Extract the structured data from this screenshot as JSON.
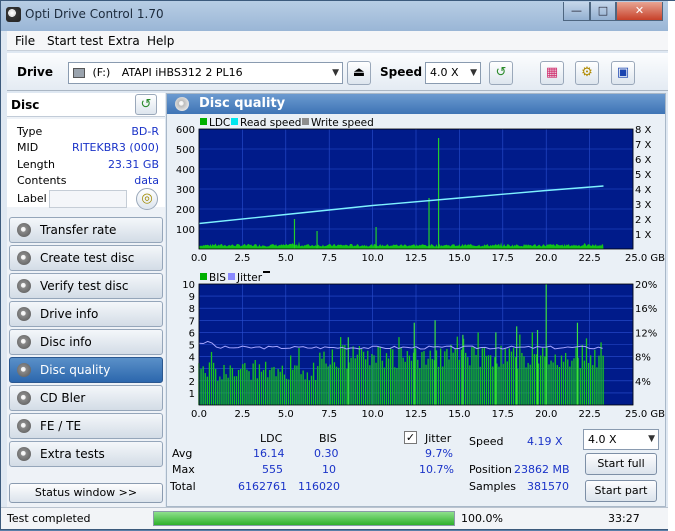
{
  "window": {
    "title": "Opti Drive Control 1.70"
  },
  "menu": {
    "file": "File",
    "start_test": "Start test",
    "extra": "Extra",
    "help": "Help"
  },
  "toolbar": {
    "drive_label": "Drive",
    "drive_letter": "(F:)",
    "drive_name": "ATAPI iHBS312  2 PL16",
    "speed_label": "Speed",
    "speed_value": "4.0 X"
  },
  "disc": {
    "heading": "Disc",
    "rows": [
      {
        "key": "Type",
        "value": "BD-R"
      },
      {
        "key": "MID",
        "value": "RITEKBR3 (000)"
      },
      {
        "key": "Length",
        "value": "23.31 GB"
      },
      {
        "key": "Contents",
        "value": "data"
      }
    ],
    "label_key": "Label",
    "label_value": ""
  },
  "nav": [
    {
      "label": "Transfer rate"
    },
    {
      "label": "Create test disc"
    },
    {
      "label": "Verify test disc"
    },
    {
      "label": "Drive info"
    },
    {
      "label": "Disc info"
    },
    {
      "label": "Disc quality",
      "active": true
    },
    {
      "label": "CD Bler"
    },
    {
      "label": "FE / TE"
    },
    {
      "label": "Extra tests"
    }
  ],
  "status_window_button": "Status window >>",
  "panel": {
    "title": "Disc quality"
  },
  "chart_data": [
    {
      "type": "line",
      "legend": [
        "LDC",
        "Read speed",
        "Write speed"
      ],
      "ylim": [
        0,
        600
      ],
      "y_ticks": [
        "600",
        "500",
        "400",
        "300",
        "200",
        "100"
      ],
      "y2_ticks": [
        "8 X",
        "7 X",
        "6 X",
        "5 X",
        "4 X",
        "3 X",
        "2 X",
        "1 X"
      ],
      "x_ticks": [
        "0.0",
        "2.5",
        "5.0",
        "7.5",
        "10.0",
        "12.5",
        "15.0",
        "17.5",
        "20.0",
        "22.5",
        "25.0 GB"
      ],
      "series": [
        {
          "name": "LDC",
          "x": [
            0,
            5,
            10,
            13.8,
            15,
            20,
            23.3
          ],
          "y": [
            20,
            20,
            18,
            555,
            20,
            22,
            30
          ]
        },
        {
          "name": "Read speed",
          "x": [
            0,
            5,
            10,
            15,
            20,
            23.3
          ],
          "y": [
            1.7,
            2.3,
            2.9,
            3.4,
            3.9,
            4.2
          ]
        }
      ]
    },
    {
      "type": "line",
      "legend": [
        "BIS",
        "Jitter"
      ],
      "ylim": [
        0,
        10
      ],
      "y_ticks": [
        "10",
        "9",
        "8",
        "7",
        "6",
        "5",
        "4",
        "3",
        "2",
        "1"
      ],
      "y2_ticks": [
        "20%",
        "16%",
        "12%",
        "8%",
        "4%"
      ],
      "x_ticks": [
        "0.0",
        "2.5",
        "5.0",
        "7.5",
        "10.0",
        "12.5",
        "15.0",
        "17.5",
        "20.0",
        "22.5",
        "25.0 GB"
      ],
      "series": [
        {
          "name": "BIS",
          "x": [
            0,
            5,
            10,
            15,
            20,
            23.3
          ],
          "y": [
            2,
            3,
            4,
            4,
            5,
            5
          ]
        },
        {
          "name": "Jitter",
          "x": [
            0,
            5,
            10,
            15,
            20,
            23.3
          ],
          "y": [
            9.7,
            9.5,
            9.6,
            9.7,
            9.8,
            9.9
          ]
        }
      ]
    }
  ],
  "stats": {
    "ldc_header": "LDC",
    "bis_header": "BIS",
    "jitter_header": "Jitter",
    "avg_label": "Avg",
    "max_label": "Max",
    "total_label": "Total",
    "ldc_avg": "16.14",
    "ldc_max": "555",
    "ldc_total": "6162761",
    "bis_avg": "0.30",
    "bis_max": "10",
    "bis_total": "116020",
    "jitter_avg": "9.7%",
    "jitter_max": "10.7%",
    "speed_label": "Speed",
    "speed_value": "4.19 X",
    "position_label": "Position",
    "position_value": "23862 MB",
    "samples_label": "Samples",
    "samples_value": "381570",
    "speed_combo": "4.0 X",
    "start_full": "Start full",
    "start_part": "Start part"
  },
  "status": {
    "text": "Test completed",
    "progress": "100.0%",
    "progress_fraction": 1.0,
    "time": "33:27"
  }
}
